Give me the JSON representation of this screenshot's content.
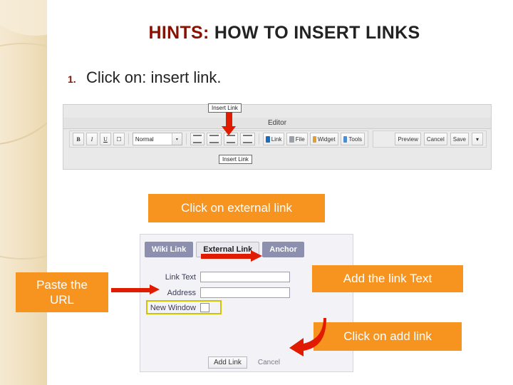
{
  "slide": {
    "title_prefix": "HINTS:",
    "title_rest": " HOW TO INSERT LINKS",
    "bullet_number": "1.",
    "bullet_text": "Click on: insert link."
  },
  "editor_screenshot": {
    "insert_link_label_top": "Insert Link",
    "insert_link_label_bottom": "Insert Link",
    "header_label": "Editor",
    "toolbar": {
      "bold": "B",
      "italic": "I",
      "underline": "U",
      "format_select": "Normal",
      "caret": "▾",
      "buttons": [
        {
          "label": "Link",
          "icon": "link-icon"
        },
        {
          "label": "File",
          "icon": "file-icon"
        },
        {
          "label": "Widget",
          "icon": "widget-icon"
        },
        {
          "label": "Tools",
          "icon": "tools-icon"
        }
      ],
      "right_buttons": [
        "Preview",
        "Cancel",
        "Save"
      ],
      "right_caret": "▾"
    }
  },
  "dialog_screenshot": {
    "tabs": [
      {
        "label": "Wiki Link",
        "active": false
      },
      {
        "label": "External Link",
        "active": true
      },
      {
        "label": "Anchor",
        "active": false
      }
    ],
    "fields": [
      {
        "label": "Link Text",
        "value": ""
      },
      {
        "label": "Address",
        "value": ""
      }
    ],
    "checkbox_label": "New Window",
    "footer_buttons": [
      "Add Link",
      "Cancel"
    ]
  },
  "callouts": {
    "external": "Click on external link",
    "paste_url_line1": "Paste the",
    "paste_url_line2": "URL",
    "add_link_text": "Add the link Text",
    "add_link": "Click on add link"
  },
  "colors": {
    "title_red": "#8a1002",
    "callout_orange": "#f79420",
    "arrow_red": "#e01b00",
    "band_beige": "#f0e0c0",
    "tab_purple": "#8c8fae",
    "highlight_yellow": "#cfc400"
  }
}
